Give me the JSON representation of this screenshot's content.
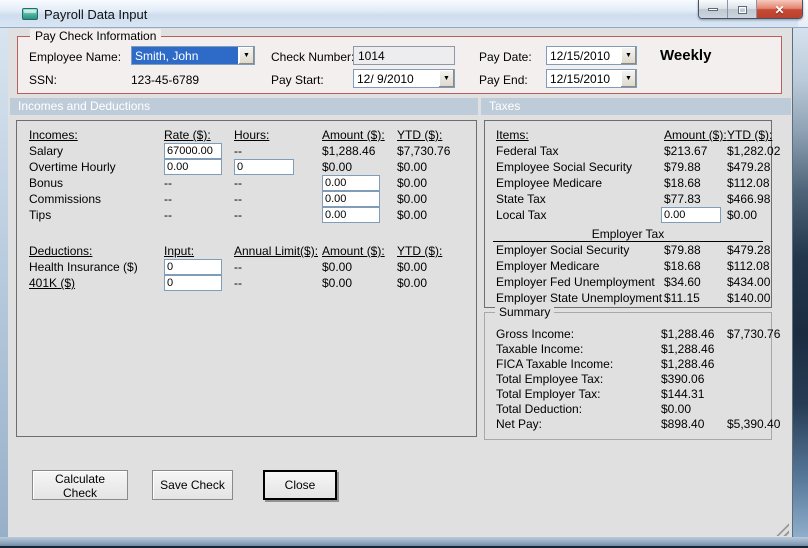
{
  "window": {
    "title": "Payroll Data Input"
  },
  "icons": {
    "dropdown": "▼",
    "close": "✕"
  },
  "colors": {
    "selection": "#2E6BC8",
    "group_border": "#B85F5F",
    "section_bar": "#BECBD8",
    "close_button": "#C74A35"
  },
  "paycheck": {
    "legend": "Pay Check Information",
    "employee_name_label": "Employee Name:",
    "employee_name_value": "Smith, John",
    "ssn_label": "SSN:",
    "ssn_value": "123-45-6789",
    "check_number_label": "Check Number:",
    "check_number_value": "1014",
    "pay_start_label": "Pay Start:",
    "pay_start_value": "12/ 9/2010",
    "pay_date_label": "Pay Date:",
    "pay_date_value": "12/15/2010",
    "pay_end_label": "Pay End:",
    "pay_end_value": "12/15/2010",
    "frequency": "Weekly"
  },
  "sections": {
    "incomes_header": "Incomes and Deductions",
    "taxes_header": "Taxes"
  },
  "incomes": {
    "col_headers": [
      "Incomes:",
      "Rate ($):",
      "Hours:",
      "Amount ($):",
      "YTD ($):"
    ],
    "rows": [
      {
        "label": "Salary",
        "rate": "67000.00",
        "hours": "--",
        "amount": "$1,288.46",
        "ytd": "$7,730.76"
      },
      {
        "label": "Overtime Hourly",
        "rate": "0.00",
        "hours": "0",
        "amount": "$0.00",
        "ytd": "$0.00"
      },
      {
        "label": "Bonus",
        "rate": "--",
        "hours": "--",
        "amount": "0.00",
        "ytd": "$0.00"
      },
      {
        "label": "Commissions",
        "rate": "--",
        "hours": "--",
        "amount": "0.00",
        "ytd": "$0.00"
      },
      {
        "label": "Tips",
        "rate": "--",
        "hours": "--",
        "amount": "0.00",
        "ytd": "$0.00"
      }
    ]
  },
  "deductions": {
    "col_headers": [
      "Deductions:",
      "Input:",
      "Annual Limit($):",
      "Amount ($):",
      "YTD ($):"
    ],
    "rows": [
      {
        "label": "Health Insurance  ($)",
        "input": "0",
        "limit": "--",
        "amount": "$0.00",
        "ytd": "$0.00"
      },
      {
        "label": "401K  ($)",
        "input": "0",
        "limit": "--",
        "amount": "$0.00",
        "ytd": "$0.00"
      }
    ]
  },
  "taxes": {
    "col_headers": [
      "Items:",
      "Amount ($):",
      "YTD ($):"
    ],
    "rows": [
      {
        "label": "Federal Tax",
        "amount": "$213.67",
        "ytd": "$1,282.02"
      },
      {
        "label": "Employee Social Security",
        "amount": "$79.88",
        "ytd": "$479.28"
      },
      {
        "label": "Employee Medicare",
        "amount": "$18.68",
        "ytd": "$112.08"
      },
      {
        "label": "State Tax",
        "amount": "$77.83",
        "ytd": "$466.98"
      },
      {
        "label": "Local Tax",
        "amount": "0.00",
        "ytd": "$0.00"
      }
    ],
    "employer_header": "Employer Tax",
    "employer_rows": [
      {
        "label": "Employer Social Security",
        "amount": "$79.88",
        "ytd": "$479.28"
      },
      {
        "label": "Employer Medicare",
        "amount": "$18.68",
        "ytd": "$112.08"
      },
      {
        "label": "Employer Fed Unemployment",
        "amount": "$34.60",
        "ytd": "$434.00"
      },
      {
        "label": "Employer State Unemployment",
        "amount": "$11.15",
        "ytd": "$140.00"
      }
    ]
  },
  "summary": {
    "legend": "Summary",
    "rows": [
      {
        "label": "Gross Income:",
        "amount": "$1,288.46",
        "ytd": "$7,730.76"
      },
      {
        "label": "Taxable Income:",
        "amount": "$1,288.46",
        "ytd": ""
      },
      {
        "label": "FICA Taxable Income:",
        "amount": "$1,288.46",
        "ytd": ""
      },
      {
        "label": "Total Employee Tax:",
        "amount": "$390.06",
        "ytd": ""
      },
      {
        "label": "Total Employer Tax:",
        "amount": "$144.31",
        "ytd": ""
      },
      {
        "label": "Total Deduction:",
        "amount": "$0.00",
        "ytd": ""
      },
      {
        "label": "Net Pay:",
        "amount": "$898.40",
        "ytd": "$5,390.40"
      }
    ]
  },
  "buttons": {
    "calculate": "Calculate Check",
    "save": "Save Check",
    "close": "Close"
  }
}
